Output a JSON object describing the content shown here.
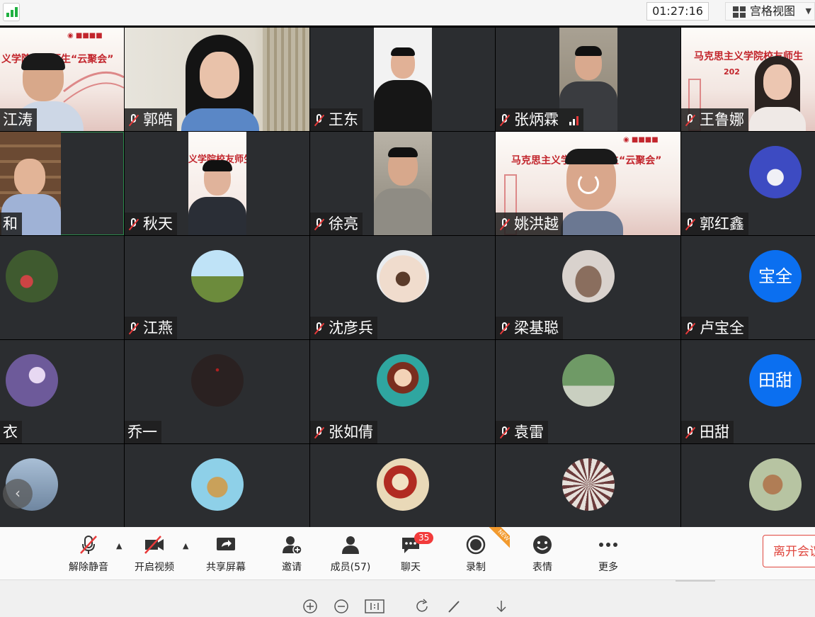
{
  "header": {
    "timer": "01:27:16",
    "view_mode": "宫格视图"
  },
  "participants": [
    {
      "name": "江涛",
      "muted": false
    },
    {
      "name": "郭皓",
      "muted": true
    },
    {
      "name": "王东",
      "muted": true
    },
    {
      "name": "张炳霖",
      "muted": true
    },
    {
      "name": "王鲁娜",
      "muted": true
    },
    {
      "name": "和",
      "muted": false
    },
    {
      "name": "秋天",
      "muted": true
    },
    {
      "name": "徐亮",
      "muted": true
    },
    {
      "name": "姚洪越",
      "muted": true
    },
    {
      "name": "郭红鑫",
      "muted": true
    },
    {
      "name": "",
      "muted": false
    },
    {
      "name": "江燕",
      "muted": true
    },
    {
      "name": "沈彦兵",
      "muted": true
    },
    {
      "name": "梁基聪",
      "muted": true
    },
    {
      "name": "卢宝全",
      "muted": true,
      "avatar_text": "宝全"
    },
    {
      "name": "衣",
      "muted": false
    },
    {
      "name": "乔一",
      "muted": false
    },
    {
      "name": "张如倩",
      "muted": true
    },
    {
      "name": "袁雷",
      "muted": true
    },
    {
      "name": "田甜",
      "muted": true,
      "avatar_text": "田甜"
    }
  ],
  "banners": {
    "b1": "义学院校友师生“云聚会”",
    "b2": "马克思主义学院校友师生",
    "b3": "马克思主义学",
    "b4": "生“云聚会”",
    "b5": "义学院校友师生",
    "year": "202"
  },
  "toolbar": {
    "unmute": "解除静音",
    "video": "开启视频",
    "share": "共享屏幕",
    "invite": "邀请",
    "members": "成员(57)",
    "chat": "聊天",
    "chat_badge": "35",
    "record": "录制",
    "new_badge": "NEW",
    "reactions": "表情",
    "more": "更多",
    "leave": "离开会议"
  },
  "colors": {
    "accent": "#0b6ff0",
    "leave": "#e0473f",
    "badge": "#f23b3b",
    "signal": "#1fb141"
  }
}
